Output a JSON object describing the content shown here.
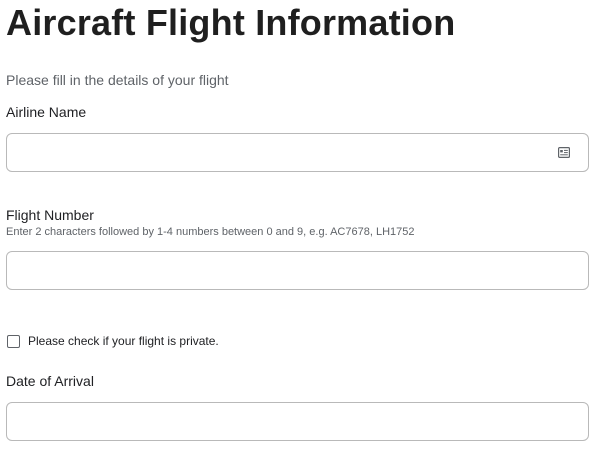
{
  "page": {
    "title": "Aircraft Flight Information",
    "subtitle": "Please fill in the details of your flight"
  },
  "fields": {
    "airline_name": {
      "label": "Airline Name",
      "value": "",
      "placeholder": "",
      "icon": "contact-card-icon"
    },
    "flight_number": {
      "label": "Flight Number",
      "hint": "Enter 2 characters followed by 1-4 numbers between 0 and 9, e.g. AC7678, LH1752",
      "value": "",
      "placeholder": ""
    },
    "private_flight": {
      "label": "Please check if your flight is private.",
      "checked": false
    },
    "date_of_arrival": {
      "label": "Date of Arrival",
      "value": "",
      "placeholder": ""
    }
  },
  "colors": {
    "title": "#1f1f1f",
    "muted_text": "#5f6368",
    "field_border": "#b9b9b9"
  }
}
